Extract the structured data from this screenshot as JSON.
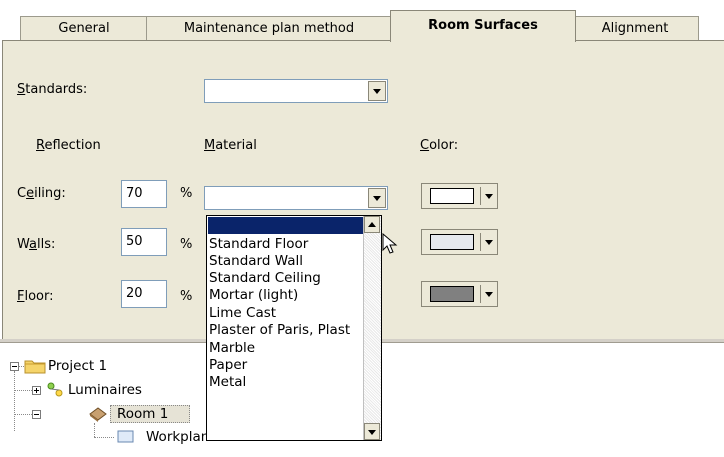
{
  "tabs": [
    {
      "id": "general",
      "label": "General",
      "active": false
    },
    {
      "id": "maintenance",
      "label": "Maintenance plan method",
      "active": false
    },
    {
      "id": "room_surfaces",
      "label": "Room Surfaces",
      "active": true
    },
    {
      "id": "alignment",
      "label": "Alignment",
      "active": false
    }
  ],
  "standards": {
    "label_pre": "",
    "label_ul": "S",
    "label_post": "tandards:",
    "value": ""
  },
  "headers": {
    "reflection": {
      "pre": "",
      "ul": "R",
      "post": "eflection"
    },
    "material": {
      "pre": "",
      "ul": "M",
      "post": "aterial"
    },
    "color": {
      "pre": "",
      "ul": "C",
      "post": "olor:"
    }
  },
  "rows": [
    {
      "label_pre": "C",
      "label_ul": "e",
      "label_post": "iling:",
      "reflection": "70",
      "unit": "%",
      "material": "",
      "color": "#ffffff"
    },
    {
      "label_pre": "W",
      "label_ul": "a",
      "label_post": "lls:",
      "reflection": "50",
      "unit": "%",
      "material": "",
      "color": "#e6e9ee"
    },
    {
      "label_pre": "",
      "label_ul": "F",
      "label_post": "loor:",
      "reflection": "20",
      "unit": "%",
      "material": "",
      "color": "#808080"
    }
  ],
  "material_options": [
    "",
    "Standard Floor",
    "Standard Wall",
    "Standard Ceiling",
    "Mortar (light)",
    "Lime Cast",
    "Plaster of Paris, Plast",
    "Marble",
    "Paper",
    "Metal"
  ],
  "tree": {
    "project": "Project 1",
    "luminaires": "Luminaires",
    "room": "Room 1",
    "workplane": "Workplane"
  },
  "icons": [
    "folder-icon",
    "luminaires-icon",
    "room-icon",
    "workplane-icon",
    "chevron-down-icon",
    "mouse-cursor-icon"
  ]
}
